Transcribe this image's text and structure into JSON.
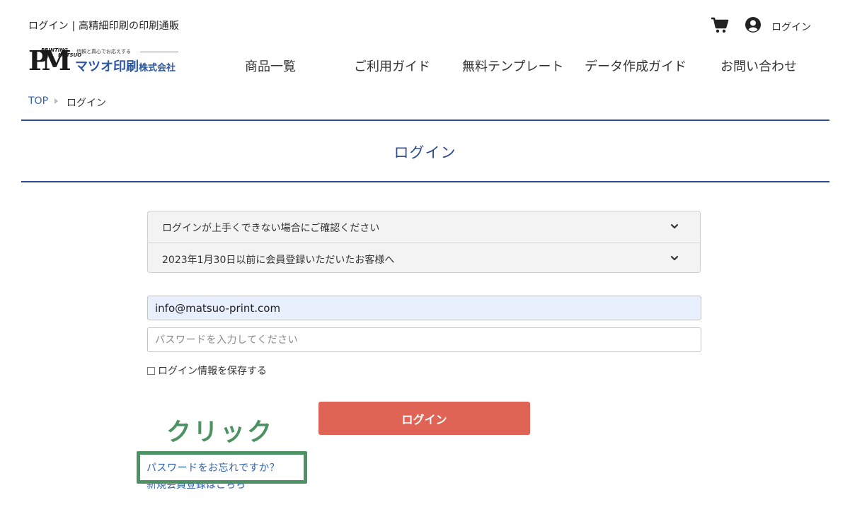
{
  "header": {
    "site_title": "ログイン | 高精細印刷の印刷通販",
    "login_label": "ログイン",
    "logo": {
      "monogram": "PM",
      "printing": "PRINTING",
      "matsuo": "MATSUO",
      "tagline": "信頼と真心でお応えする",
      "name": "マツオ印刷",
      "suffix": "株式会社"
    }
  },
  "nav": {
    "items": [
      {
        "label": "商品一覧"
      },
      {
        "label": "ご利用ガイド"
      },
      {
        "label": "無料テンプレート"
      },
      {
        "label": "データ作成ガイド"
      },
      {
        "label": "お問い合わせ"
      }
    ]
  },
  "breadcrumb": {
    "top": "TOP",
    "current": "ログイン"
  },
  "page": {
    "heading": "ログイン"
  },
  "accordion": [
    {
      "label": "ログインが上手くできない場合にご確認ください"
    },
    {
      "label": "2023年1月30日以前に会員登録いただいたお客様へ"
    }
  ],
  "form": {
    "email_value": "info@matsuo-print.com",
    "password_placeholder": "パスワードを入力してください",
    "remember_label": "ログイン情報を保存する",
    "login_button": "ログイン",
    "forgot_password": "パスワードをお忘れですか？",
    "register": "新規会員登録はこちら"
  },
  "annotation": {
    "text": "クリック",
    "color": "#4d9262"
  },
  "colors": {
    "brand_blue": "#2d4b8f",
    "link_blue": "#2f63b0",
    "button_red": "#e06455"
  },
  "icons": {
    "cart": "cart-icon",
    "user": "user-circle-icon",
    "breadcrumb_separator": "triangle-right-icon",
    "accordion_toggle": "chevron-down-icon"
  }
}
